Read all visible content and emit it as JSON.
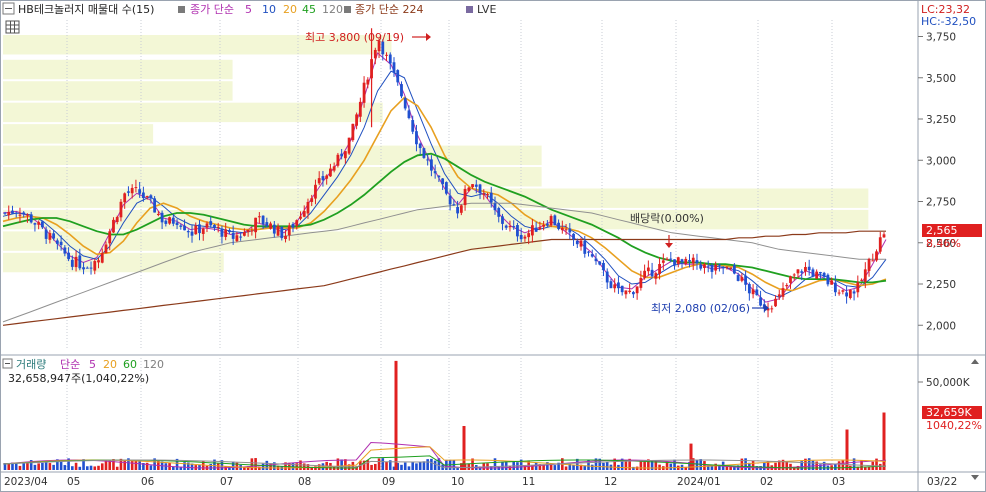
{
  "price_panel": {
    "legend": {
      "title": "HB테크놀러지 매물대 수(15)",
      "ma_label": "종가 단순",
      "ma_periods": [
        "5",
        "10",
        "20",
        "45",
        "120"
      ],
      "ma_colors": [
        "#b030b0",
        "#2050c0",
        "#e8a020",
        "#20a020",
        "#909090"
      ],
      "ma224_label": "종가 단순 224",
      "ma224_color": "#8b3a1a",
      "lve_label": "LVE"
    },
    "lc_label": "LC:23,32",
    "hc_label": "HC:-32,50",
    "high_annotation": "최고 3,800 (09/19)",
    "low_annotation": "최저 2,080 (02/06)",
    "dividend_annotation": "배당락(0.00%)",
    "current_price": "2,565",
    "current_change": "8.46%"
  },
  "volume_panel": {
    "legend": {
      "title": "거래량",
      "ma_label": "단순",
      "ma_periods": [
        "5",
        "20",
        "60",
        "120"
      ],
      "ma_colors": [
        "#b030b0",
        "#e8a020",
        "#20a020",
        "#909090"
      ]
    },
    "summary": "32,658,947주(1,040,22%)",
    "current_volume": "32,659K",
    "current_ratio": "1040,22%",
    "axis_label": "50,000K"
  },
  "chart_data": {
    "type": "candlestick",
    "y_axis": {
      "min": 1850,
      "max": 3850,
      "ticks": [
        "2,000",
        "2,250",
        "2,500",
        "2,750",
        "3,000",
        "3,250",
        "3,500",
        "3,750"
      ]
    },
    "x_axis": {
      "labels": [
        "2023/04",
        "05",
        "06",
        "07",
        "08",
        "09",
        "10",
        "11",
        "12",
        "2024/01",
        "02",
        "03",
        "03/22"
      ]
    },
    "close_path": [
      2680,
      2700,
      2640,
      2560,
      2470,
      2390,
      2360,
      2400,
      2600,
      2800,
      2810,
      2730,
      2620,
      2640,
      2560,
      2600,
      2580,
      2530,
      2560,
      2640,
      2600,
      2540,
      2650,
      2800,
      2900,
      3000,
      3150,
      3450,
      3750,
      3550,
      3350,
      3100,
      2950,
      2800,
      2700,
      2880,
      2800,
      2650,
      2580,
      2540,
      2600,
      2650,
      2560,
      2500,
      2420,
      2300,
      2200,
      2200,
      2300,
      2350,
      2400,
      2370,
      2380,
      2330,
      2350,
      2300,
      2200,
      2120,
      2150,
      2280,
      2350,
      2300,
      2250,
      2200,
      2220,
      2400,
      2565
    ],
    "moving_averages": [
      {
        "name": "5",
        "values": [
          2680,
          2690,
          2660,
          2600,
          2500,
          2420,
          2380,
          2410,
          2560,
          2730,
          2800,
          2760,
          2650,
          2630,
          2580,
          2590,
          2580,
          2550,
          2560,
          2620,
          2600,
          2560,
          2630,
          2760,
          2880,
          2980,
          3120,
          3380,
          3650,
          3580,
          3400,
          3150,
          2980,
          2830,
          2730,
          2830,
          2790,
          2680,
          2600,
          2560,
          2590,
          2630,
          2570,
          2510,
          2440,
          2330,
          2230,
          2220,
          2290,
          2340,
          2390,
          2370,
          2370,
          2340,
          2350,
          2310,
          2220,
          2140,
          2160,
          2260,
          2330,
          2300,
          2260,
          2210,
          2230,
          2370,
          2520
        ]
      },
      {
        "name": "10",
        "values": [
          2660,
          2680,
          2670,
          2630,
          2560,
          2480,
          2420,
          2400,
          2480,
          2620,
          2740,
          2780,
          2720,
          2650,
          2610,
          2600,
          2590,
          2570,
          2560,
          2580,
          2600,
          2580,
          2600,
          2680,
          2790,
          2900,
          3030,
          3200,
          3420,
          3540,
          3500,
          3300,
          3100,
          2920,
          2800,
          2780,
          2800,
          2740,
          2660,
          2600,
          2580,
          2600,
          2600,
          2550,
          2480,
          2400,
          2300,
          2250,
          2260,
          2310,
          2360,
          2380,
          2380,
          2360,
          2350,
          2330,
          2270,
          2200,
          2170,
          2210,
          2280,
          2310,
          2280,
          2240,
          2230,
          2290,
          2400
        ]
      },
      {
        "name": "20",
        "values": [
          2630,
          2650,
          2660,
          2650,
          2610,
          2550,
          2480,
          2430,
          2440,
          2510,
          2620,
          2710,
          2740,
          2710,
          2660,
          2630,
          2610,
          2590,
          2580,
          2580,
          2590,
          2590,
          2590,
          2620,
          2690,
          2780,
          2880,
          3000,
          3150,
          3300,
          3380,
          3330,
          3200,
          3030,
          2900,
          2830,
          2810,
          2790,
          2740,
          2670,
          2620,
          2600,
          2590,
          2570,
          2530,
          2470,
          2400,
          2330,
          2290,
          2290,
          2320,
          2350,
          2370,
          2370,
          2360,
          2350,
          2310,
          2260,
          2220,
          2210,
          2240,
          2270,
          2280,
          2260,
          2240,
          2250,
          2280
        ]
      },
      {
        "name": "45",
        "values": [
          2600,
          2620,
          2640,
          2650,
          2650,
          2630,
          2600,
          2570,
          2550,
          2550,
          2580,
          2620,
          2660,
          2680,
          2680,
          2670,
          2650,
          2630,
          2610,
          2600,
          2600,
          2600,
          2600,
          2610,
          2640,
          2680,
          2730,
          2790,
          2860,
          2930,
          2990,
          3030,
          3040,
          3010,
          2960,
          2910,
          2870,
          2840,
          2810,
          2780,
          2740,
          2700,
          2670,
          2640,
          2610,
          2570,
          2530,
          2480,
          2440,
          2410,
          2390,
          2380,
          2380,
          2370,
          2370,
          2360,
          2350,
          2330,
          2310,
          2290,
          2280,
          2280,
          2280,
          2270,
          2260,
          2260,
          2270
        ]
      },
      {
        "name": "120",
        "values": [
          2020,
          2050,
          2080,
          2110,
          2140,
          2170,
          2200,
          2230,
          2260,
          2290,
          2320,
          2350,
          2380,
          2410,
          2440,
          2460,
          2480,
          2500,
          2510,
          2520,
          2530,
          2540,
          2550,
          2560,
          2570,
          2580,
          2600,
          2620,
          2640,
          2660,
          2680,
          2700,
          2710,
          2720,
          2730,
          2740,
          2740,
          2740,
          2740,
          2730,
          2720,
          2710,
          2700,
          2690,
          2680,
          2660,
          2640,
          2620,
          2600,
          2580,
          2560,
          2550,
          2540,
          2530,
          2520,
          2510,
          2500,
          2480,
          2460,
          2450,
          2440,
          2430,
          2420,
          2410,
          2400,
          2400,
          2400
        ]
      },
      {
        "name": "224",
        "values": [
          2000,
          2010,
          2020,
          2030,
          2040,
          2050,
          2060,
          2070,
          2080,
          2090,
          2100,
          2110,
          2120,
          2130,
          2140,
          2150,
          2160,
          2170,
          2180,
          2190,
          2200,
          2210,
          2220,
          2230,
          2240,
          2260,
          2280,
          2300,
          2320,
          2340,
          2360,
          2380,
          2400,
          2420,
          2440,
          2460,
          2470,
          2480,
          2490,
          2500,
          2510,
          2520,
          2520,
          2520,
          2520,
          2520,
          2520,
          2520,
          2520,
          2520,
          2520,
          2520,
          2520,
          2520,
          2520,
          2530,
          2530,
          2540,
          2540,
          2550,
          2550,
          2560,
          2560,
          2560,
          2570,
          2570,
          2570
        ]
      }
    ],
    "volume_spikes": [
      {
        "month_index": 5,
        "value": 62000
      },
      {
        "month_index": 6,
        "value": 25000
      },
      {
        "month_index": 9,
        "value": 15000
      },
      {
        "month_index": 11,
        "value": 23000
      },
      {
        "month_index": 12,
        "value": 32659
      }
    ]
  }
}
